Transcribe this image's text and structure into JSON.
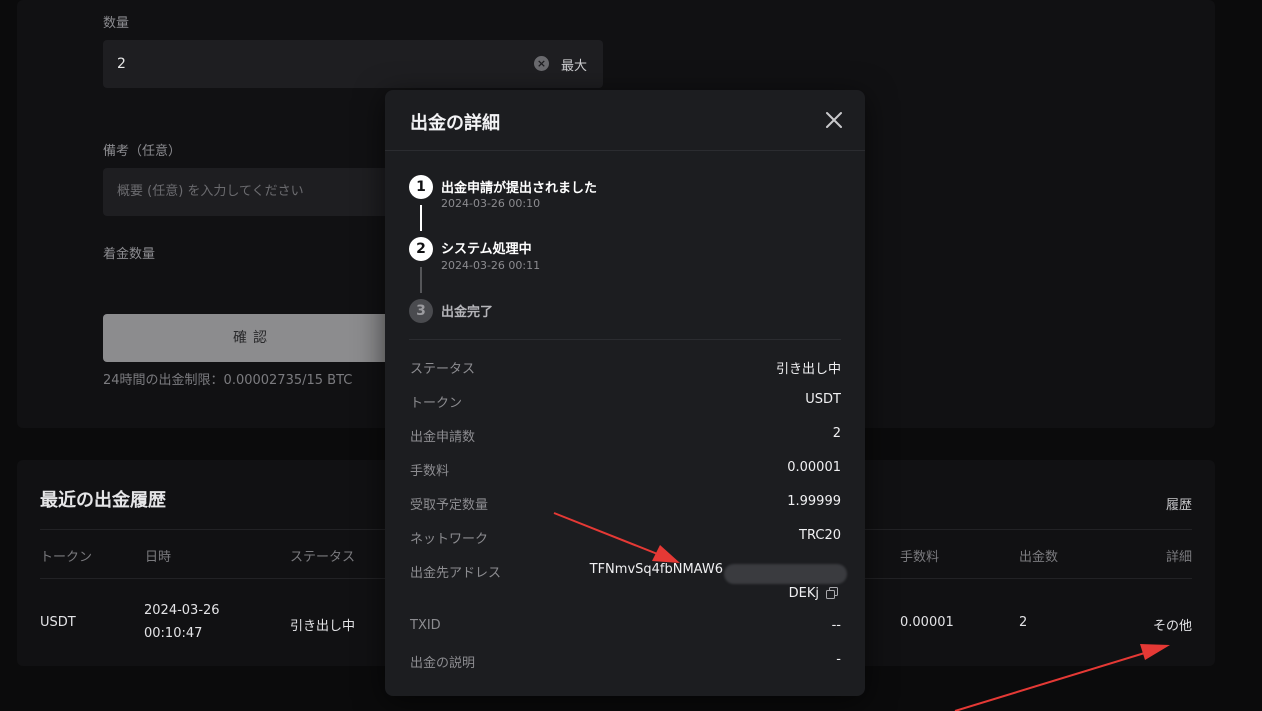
{
  "form": {
    "qty_label": "数量",
    "qty_value": "2",
    "max_label": "最大",
    "memo_label": "備考（任意）",
    "memo_placeholder": "概要 (任意) を入力してください",
    "receive_label": "着金数量",
    "confirm_label": "確認",
    "limit_text": "24時間の出金制限：0.00002735/15 BTC"
  },
  "history": {
    "title": "最近の出金履歴",
    "link": "履歴",
    "headers": {
      "token": "トークン",
      "datetime": "日時",
      "status": "ステータス",
      "fee": "手数料",
      "amount": "出金数",
      "details": "詳細"
    },
    "row": {
      "token": "USDT",
      "date": "2024-03-26",
      "time": "00:10:47",
      "status": "引き出し中",
      "fee": "0.00001",
      "amount": "2",
      "details": "その他"
    }
  },
  "modal": {
    "title": "出金の詳細",
    "steps": [
      {
        "num": "1",
        "title": "出金申請が提出されました",
        "time": "2024-03-26 00:10"
      },
      {
        "num": "2",
        "title": "システム処理中",
        "time": "2024-03-26 00:11"
      },
      {
        "num": "3",
        "title": "出金完了",
        "time": ""
      }
    ],
    "rows": {
      "status": {
        "label": "ステータス",
        "value": "引き出し中"
      },
      "token": {
        "label": "トークン",
        "value": "USDT"
      },
      "amount": {
        "label": "出金申請数",
        "value": "2"
      },
      "fee": {
        "label": "手数料",
        "value": "0.00001"
      },
      "receive": {
        "label": "受取予定数量",
        "value": "1.99999"
      },
      "network": {
        "label": "ネットワーク",
        "value": "TRC20"
      },
      "address": {
        "label": "出金先アドレス",
        "value_start": "TFNmvSq4fbNMAW6",
        "value_end": "DEKj"
      },
      "txid": {
        "label": "TXID",
        "value": "--"
      },
      "memo": {
        "label": "出金の説明",
        "value": "-"
      }
    }
  },
  "colors": {
    "accent_arrow": "#e53935",
    "background": "#0b0b0c",
    "modal": "#1c1d20"
  }
}
